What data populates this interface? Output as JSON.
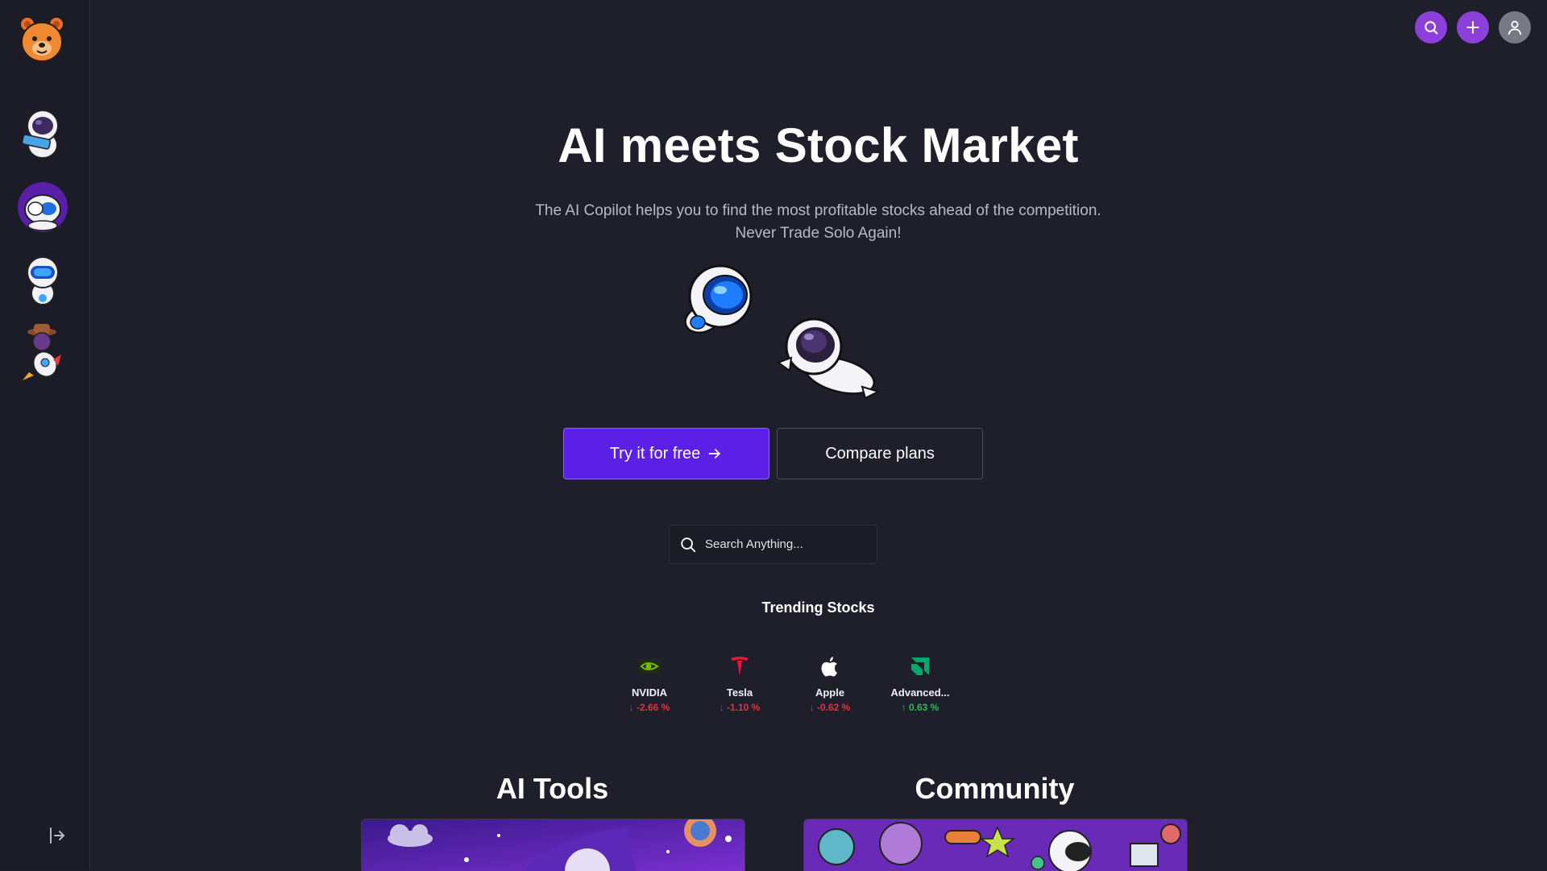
{
  "hero": {
    "title": "AI meets Stock Market",
    "subtitle_line1": "The AI Copilot helps you to find the most profitable stocks ahead of the competition.",
    "subtitle_line2": "Never Trade Solo Again!"
  },
  "cta": {
    "primary_label": "Try it for free",
    "primary_icon": "arrow-right-icon",
    "secondary_label": "Compare plans"
  },
  "search": {
    "placeholder": "Search Anything...",
    "value": ""
  },
  "trending": {
    "title": "Trending Stocks",
    "stocks": [
      {
        "name": "NVIDIA",
        "change": "-2.66 %",
        "direction": "down",
        "icon": "nvidia-logo-icon"
      },
      {
        "name": "Tesla",
        "change": "-1.10 %",
        "direction": "down",
        "icon": "tesla-logo-icon"
      },
      {
        "name": "Apple",
        "change": "-0.62 %",
        "direction": "down",
        "icon": "apple-logo-icon"
      },
      {
        "name": "Advanced...",
        "change": "0.63 %",
        "direction": "up",
        "icon": "amd-logo-icon"
      }
    ]
  },
  "sections": {
    "ai_tools": "AI Tools",
    "community": "Community"
  },
  "sidebar": {
    "items": [
      "astronaut-momo-bot",
      "astronaut-purple-bot",
      "robot-bot",
      "cowboy-rocket-bot"
    ]
  },
  "colors": {
    "background": "#1e1f2b",
    "accent": "#5b1fe6",
    "button_purple": "#8c3fd9",
    "negative": "#e2323f",
    "positive": "#2fb55a"
  }
}
